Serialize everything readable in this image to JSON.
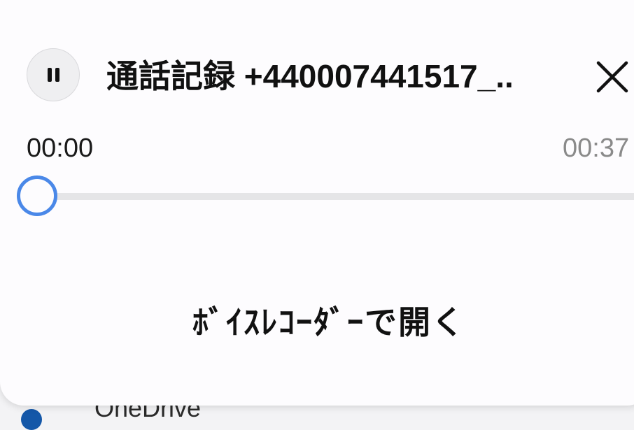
{
  "backdrop": {
    "item_label": "OneDrive"
  },
  "player": {
    "title": "通話記録 +440007441517_..",
    "current_time": "00:00",
    "total_time": "00:37",
    "progress": 0,
    "open_button_label": "ﾎﾞｲｽﾚｺｰﾀﾞｰで開く",
    "pause_icon": "pause-icon",
    "close_icon": "close-icon"
  },
  "colors": {
    "accent": "#4a88e8",
    "sheet_background": "#fdfcfe",
    "track": "#e5e5e7",
    "muted_text": "#8a8a8a"
  }
}
